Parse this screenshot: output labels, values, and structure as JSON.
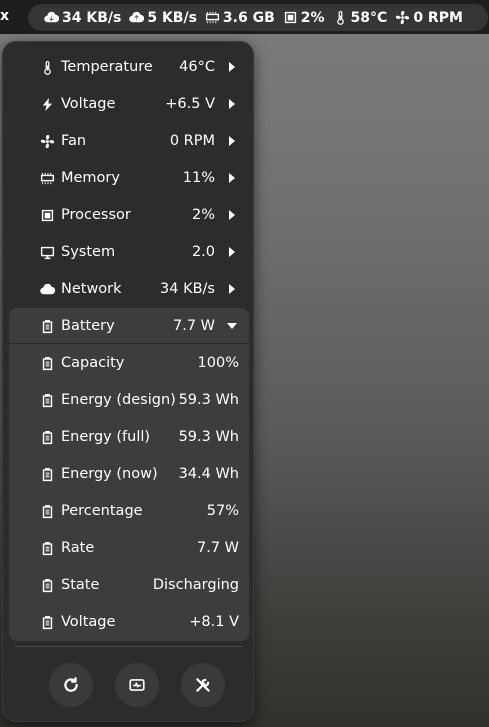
{
  "topbar": {
    "edge_text": "x",
    "indicators": [
      {
        "icon": "cloud-download-icon",
        "value": "34 KB/s"
      },
      {
        "icon": "cloud-upload-icon",
        "value": "5 KB/s"
      },
      {
        "icon": "memory-chip-icon",
        "value": "3.6 GB"
      },
      {
        "icon": "processor-icon",
        "value": "2%"
      },
      {
        "icon": "thermometer-icon",
        "value": "58°C"
      },
      {
        "icon": "fan-icon",
        "value": "0 RPM"
      }
    ]
  },
  "menu": {
    "items": [
      {
        "icon": "thermometer-icon",
        "label": "Temperature",
        "value": "46°C"
      },
      {
        "icon": "lightning-icon",
        "label": "Voltage",
        "value": "+6.5 V"
      },
      {
        "icon": "fan-icon",
        "label": "Fan",
        "value": "0 RPM"
      },
      {
        "icon": "memory-chip-icon",
        "label": "Memory",
        "value": "11%"
      },
      {
        "icon": "processor-icon",
        "label": "Processor",
        "value": "2%"
      },
      {
        "icon": "monitor-icon",
        "label": "System",
        "value": "2.0"
      },
      {
        "icon": "cloud-icon",
        "label": "Network",
        "value": "34 KB/s"
      }
    ],
    "battery": {
      "icon": "battery-icon",
      "label": "Battery",
      "value": "7.7 W"
    },
    "battery_details": [
      {
        "icon": "battery-icon",
        "label": "Capacity",
        "value": "100%"
      },
      {
        "icon": "battery-icon",
        "label": "Energy (design)",
        "value": "59.3 Wh"
      },
      {
        "icon": "battery-icon",
        "label": "Energy (full)",
        "value": "59.3 Wh"
      },
      {
        "icon": "battery-icon",
        "label": "Energy (now)",
        "value": "34.4 Wh"
      },
      {
        "icon": "battery-icon",
        "label": "Percentage",
        "value": "57%"
      },
      {
        "icon": "battery-icon",
        "label": "Rate",
        "value": "7.7 W"
      },
      {
        "icon": "battery-icon",
        "label": "State",
        "value": "Discharging"
      },
      {
        "icon": "battery-icon",
        "label": "Voltage",
        "value": "+8.1 V"
      }
    ],
    "buttons": [
      {
        "icon": "refresh-icon"
      },
      {
        "icon": "system-monitor-icon"
      },
      {
        "icon": "settings-tools-icon"
      }
    ]
  }
}
